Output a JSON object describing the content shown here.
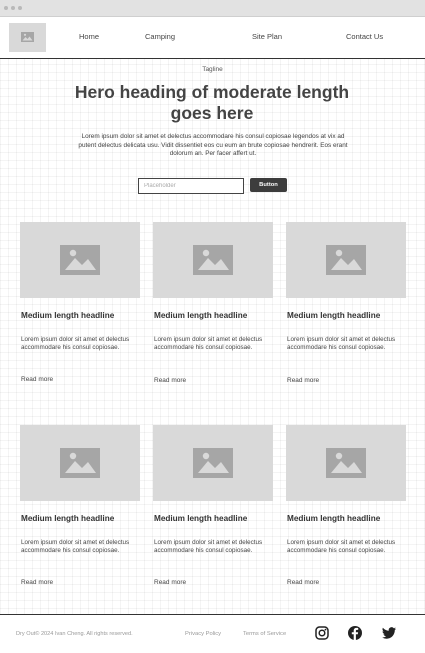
{
  "nav": {
    "logo_icon": "image-placeholder-icon",
    "links": [
      "Home",
      "Camping",
      "Site Plan",
      "Contact Us"
    ]
  },
  "hero": {
    "tagline": "Tagline",
    "heading": "Hero heading of moderate length goes here",
    "body": "Lorem ipsum dolor sit amet et delectus accommodare his consul copiosae legendos at vix ad putent delectus delicata usu. Vidit dissentiet eos cu eum an brute copiosae hendrerit. Eos erant dolorum an. Per facer affert ut.",
    "input_placeholder": "Placeholder",
    "input_value": "",
    "button_label": "Button"
  },
  "cards": [
    {
      "image_icon": "image-placeholder-icon",
      "headline": "Medium length headline",
      "text": "Lorem ipsum dolor sit amet et delectus accommodare his consul copiosae.",
      "link": "Read more"
    },
    {
      "image_icon": "image-placeholder-icon",
      "headline": "Medium length headline",
      "text": "Lorem ipsum dolor sit amet et delectus accommodare his consul copiosae.",
      "link": "Read more"
    },
    {
      "image_icon": "image-placeholder-icon",
      "headline": "Medium length headline",
      "text": "Lorem ipsum dolor sit amet et delectus accommodare his consul copiosae.",
      "link": "Read more"
    },
    {
      "image_icon": "image-placeholder-icon",
      "headline": "Medium length headline",
      "text": "Lorem ipsum dolor sit amet et delectus accommodare his consul copiosae.",
      "link": "Read more"
    },
    {
      "image_icon": "image-placeholder-icon",
      "headline": "Medium length headline",
      "text": "Lorem ipsum dolor sit amet et delectus accommodare his consul copiosae.",
      "link": "Read more"
    },
    {
      "image_icon": "image-placeholder-icon",
      "headline": "Medium length headline",
      "text": "Lorem ipsum dolor sit amet et delectus accommodare his consul copiosae.",
      "link": "Read more"
    }
  ],
  "footer": {
    "copyright": "Dry Out© 2024 Ivan Cheng. All rights reserved.",
    "privacy": "Privacy Policy",
    "terms": "Terms of Service",
    "social_icons": [
      "instagram-icon",
      "facebook-icon",
      "twitter-icon"
    ]
  },
  "colors": {
    "placeholder_gray": "#d9d9d9",
    "placeholder_icon": "#a6a6a6",
    "button_dark": "#3d3d3d",
    "text_dark": "#333333"
  }
}
